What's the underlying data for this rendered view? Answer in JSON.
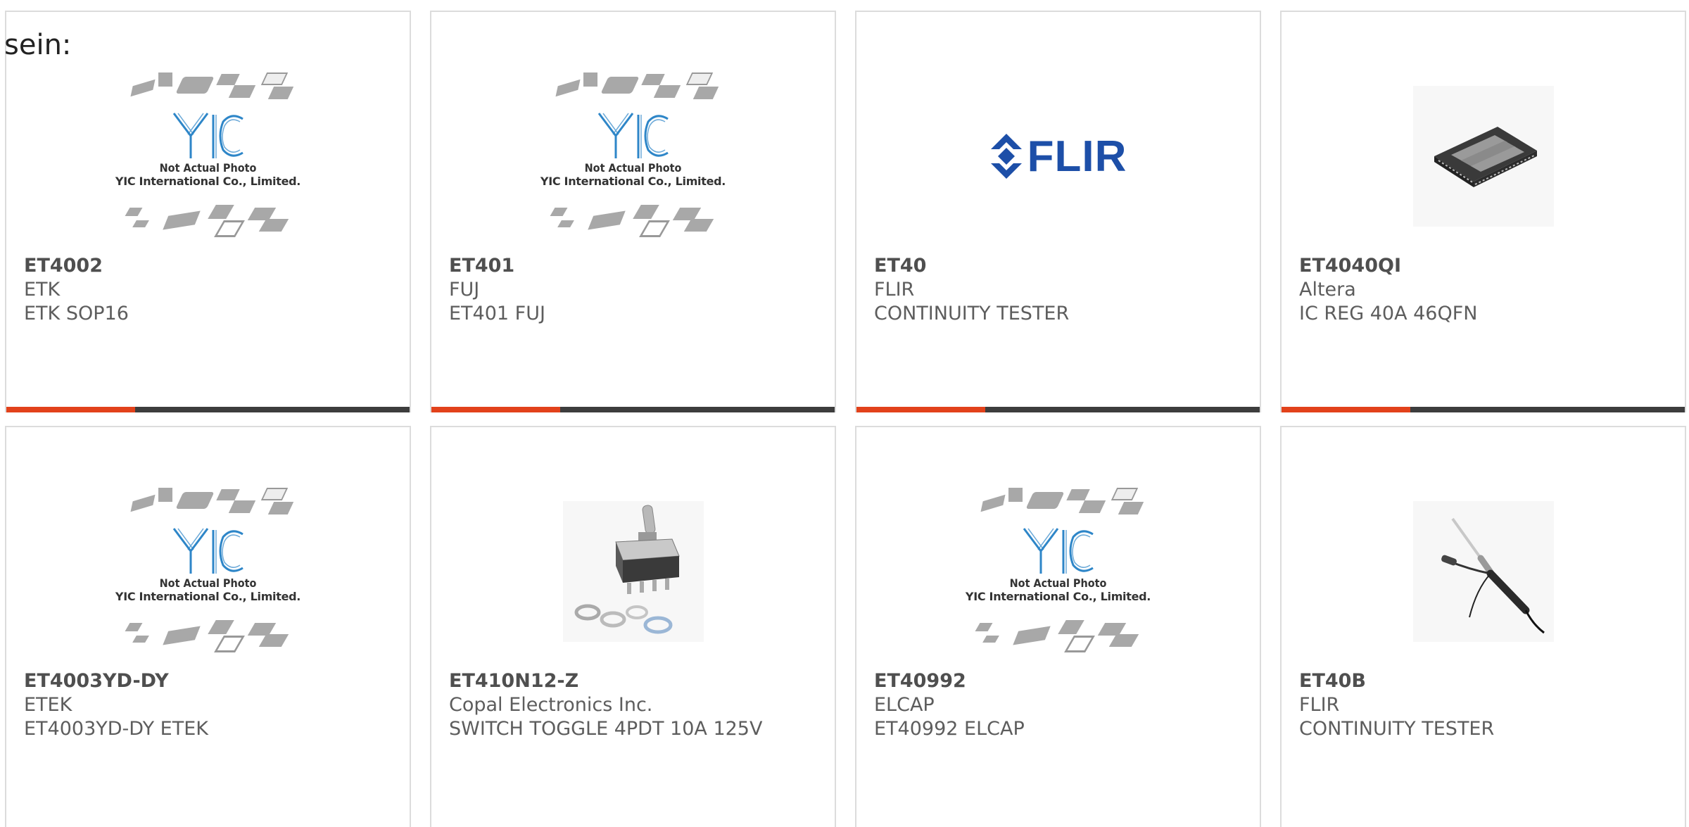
{
  "prefix_text": "sein:",
  "placeholder": {
    "line1": "Not Actual Photo",
    "line2": "YIC International Co., Limited."
  },
  "flir_logo_text": "FLIR",
  "cards": [
    {
      "part": "ET4002",
      "maker": "ETK",
      "desc": "ETK SOP16",
      "image": "placeholder"
    },
    {
      "part": "ET401",
      "maker": "FUJ",
      "desc": "ET401 FUJ",
      "image": "placeholder"
    },
    {
      "part": "ET40",
      "maker": "FLIR",
      "desc": "CONTINUITY TESTER",
      "image": "flir-logo"
    },
    {
      "part": "ET4040QI",
      "maker": "Altera",
      "desc": "IC REG 40A 46QFN",
      "image": "qfn-chip"
    },
    {
      "part": "ET4003YD-DY",
      "maker": "ETEK",
      "desc": "ET4003YD-DY ETEK",
      "image": "placeholder"
    },
    {
      "part": "ET410N12-Z",
      "maker": "Copal Electronics Inc.",
      "desc": "SWITCH TOGGLE 4PDT 10A 125V",
      "image": "toggle-switch"
    },
    {
      "part": "ET40992",
      "maker": "ELCAP",
      "desc": "ET40992 ELCAP",
      "image": "placeholder"
    },
    {
      "part": "ET40B",
      "maker": "FLIR",
      "desc": "CONTINUITY TESTER",
      "image": "tester-probe"
    }
  ],
  "colors": {
    "accent": "#e2421b",
    "bar": "#3d3d3d",
    "flir_blue": "#1d4fa8",
    "yic_blue": "#2e86c8"
  }
}
